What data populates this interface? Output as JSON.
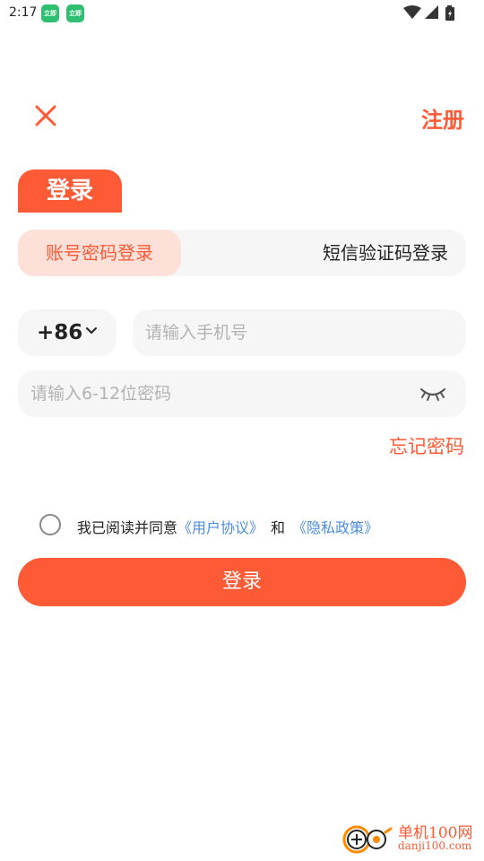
{
  "status_bar": {
    "time": "2:17",
    "notification_badge": "立即"
  },
  "header": {
    "register_label": "注册"
  },
  "login": {
    "heading": "登录",
    "mode_password": "账号密码登录",
    "mode_sms": "短信验证码登录",
    "country_code": "+86",
    "phone_placeholder": "请输入手机号",
    "password_placeholder": "请输入6-12位密码",
    "forgot_password": "忘记密码",
    "agree_prefix": "我已阅读并同意",
    "user_agreement": "《用户协议》",
    "and": "和",
    "privacy_policy": "《隐私政策》",
    "submit_label": "登录"
  },
  "watermark": {
    "title": "单机100网",
    "url": "danji100.com"
  },
  "colors": {
    "accent": "#ff5a36",
    "accent_soft": "#fde1d9",
    "link": "#4c8de0",
    "field_bg": "#f6f6f6"
  }
}
